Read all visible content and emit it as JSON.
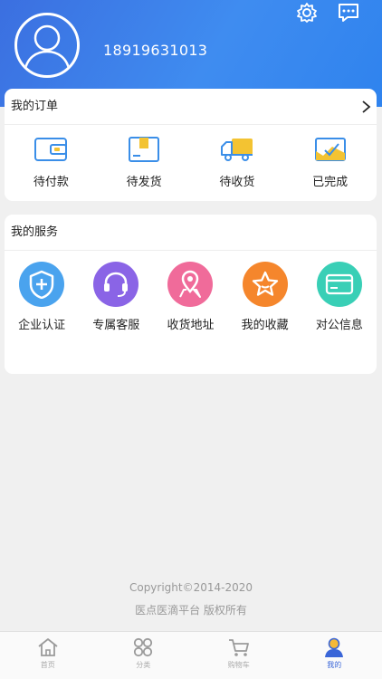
{
  "header": {
    "phone": "18919631013",
    "icons": [
      "settings-icon",
      "message-icon"
    ]
  },
  "orders": {
    "title": "我的订单",
    "items": [
      {
        "label": "待付款",
        "icon": "wallet-icon"
      },
      {
        "label": "待发货",
        "icon": "package-icon"
      },
      {
        "label": "待收货",
        "icon": "truck-icon"
      },
      {
        "label": "已完成",
        "icon": "completed-icon"
      }
    ]
  },
  "services": {
    "title": "我的服务",
    "items": [
      {
        "label": "企业认证",
        "icon": "shield-plus-icon",
        "color": "#4aa3ee"
      },
      {
        "label": "专属客服",
        "icon": "headset-icon",
        "color": "#8a64e6"
      },
      {
        "label": "收货地址",
        "icon": "location-pin-icon",
        "color": "#f06b9a"
      },
      {
        "label": "我的收藏",
        "icon": "star-icon",
        "color": "#f5862c"
      },
      {
        "label": "对公信息",
        "icon": "card-icon",
        "color": "#39cfb6"
      }
    ]
  },
  "footer": {
    "copyright": "Copyright©2014-2020",
    "rights": "医点医滴平台 版权所有"
  },
  "tabbar": {
    "items": [
      {
        "label": "首页",
        "icon": "home-icon"
      },
      {
        "label": "分类",
        "icon": "category-icon"
      },
      {
        "label": "购物车",
        "icon": "cart-icon"
      },
      {
        "label": "我的",
        "icon": "profile-icon"
      }
    ],
    "active_color": "#3a66d8"
  }
}
